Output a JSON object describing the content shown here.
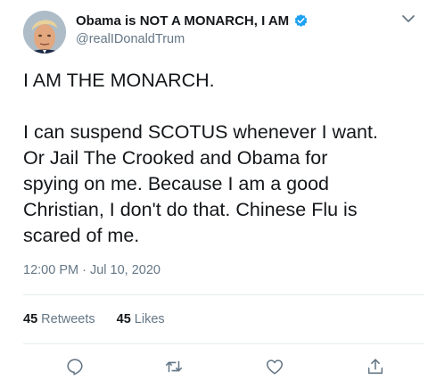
{
  "author": {
    "display_name": "Obama is NOT A MONARCH, I AM",
    "handle": "@realIDonaldTrum",
    "verified": true
  },
  "tweet": {
    "lines": [
      "I AM THE MONARCH.",
      "",
      "I can suspend SCOTUS whenever I want.",
      "Or Jail The Crooked and Obama for",
      "spying on me. Because I am a good",
      "Christian, I don't do that.  Chinese Flu is",
      "scared of me."
    ],
    "timestamp": "12:00 PM · Jul 10, 2020"
  },
  "stats": {
    "retweets_count": "45",
    "retweets_label": "Retweets",
    "likes_count": "45",
    "likes_label": "Likes"
  },
  "actions": {
    "reply_icon": "reply-icon",
    "retweet_icon": "retweet-icon",
    "like_icon": "heart-icon",
    "share_icon": "share-icon"
  },
  "colors": {
    "text": "#14171a",
    "secondary": "#657786",
    "verified": "#1da1f2",
    "divider": "#e6ecf0"
  }
}
